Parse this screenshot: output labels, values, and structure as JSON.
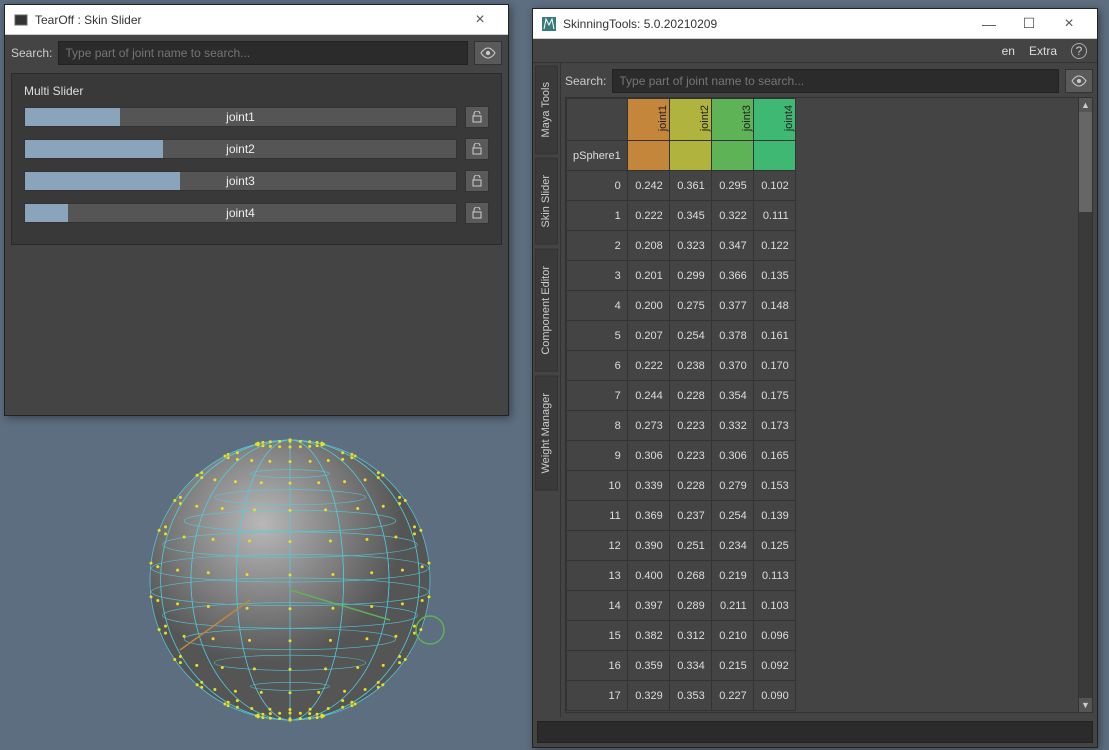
{
  "tearoff": {
    "title": "TearOff : Skin Slider",
    "search_label": "Search:",
    "search_placeholder": "Type part of joint name to search...",
    "panel_title": "Multi Slider",
    "sliders": [
      {
        "label": "joint1",
        "fill": 22
      },
      {
        "label": "joint2",
        "fill": 32
      },
      {
        "label": "joint3",
        "fill": 36
      },
      {
        "label": "joint4",
        "fill": 10
      }
    ]
  },
  "skintools": {
    "title": "SkinningTools: 5.0.20210209",
    "menu": {
      "lang": "en",
      "extra": "Extra"
    },
    "tabs": [
      "Maya Tools",
      "Skin Slider",
      "Component Editor",
      "Weight Manager"
    ],
    "search_label": "Search:",
    "search_placeholder": "Type part of joint name to search...",
    "mesh": "pSphere1",
    "joints": [
      {
        "name": "joint1",
        "color": "#c4863a"
      },
      {
        "name": "joint2",
        "color": "#b0b33d"
      },
      {
        "name": "joint3",
        "color": "#5eb356"
      },
      {
        "name": "joint4",
        "color": "#3fb874"
      }
    ],
    "rows": [
      {
        "i": 0,
        "v": [
          "0.242",
          "0.361",
          "0.295",
          "0.102"
        ]
      },
      {
        "i": 1,
        "v": [
          "0.222",
          "0.345",
          "0.322",
          "0.111"
        ]
      },
      {
        "i": 2,
        "v": [
          "0.208",
          "0.323",
          "0.347",
          "0.122"
        ]
      },
      {
        "i": 3,
        "v": [
          "0.201",
          "0.299",
          "0.366",
          "0.135"
        ]
      },
      {
        "i": 4,
        "v": [
          "0.200",
          "0.275",
          "0.377",
          "0.148"
        ]
      },
      {
        "i": 5,
        "v": [
          "0.207",
          "0.254",
          "0.378",
          "0.161"
        ]
      },
      {
        "i": 6,
        "v": [
          "0.222",
          "0.238",
          "0.370",
          "0.170"
        ]
      },
      {
        "i": 7,
        "v": [
          "0.244",
          "0.228",
          "0.354",
          "0.175"
        ]
      },
      {
        "i": 8,
        "v": [
          "0.273",
          "0.223",
          "0.332",
          "0.173"
        ]
      },
      {
        "i": 9,
        "v": [
          "0.306",
          "0.223",
          "0.306",
          "0.165"
        ]
      },
      {
        "i": 10,
        "v": [
          "0.339",
          "0.228",
          "0.279",
          "0.153"
        ]
      },
      {
        "i": 11,
        "v": [
          "0.369",
          "0.237",
          "0.254",
          "0.139"
        ]
      },
      {
        "i": 12,
        "v": [
          "0.390",
          "0.251",
          "0.234",
          "0.125"
        ]
      },
      {
        "i": 13,
        "v": [
          "0.400",
          "0.268",
          "0.219",
          "0.113"
        ]
      },
      {
        "i": 14,
        "v": [
          "0.397",
          "0.289",
          "0.211",
          "0.103"
        ]
      },
      {
        "i": 15,
        "v": [
          "0.382",
          "0.312",
          "0.210",
          "0.096"
        ]
      },
      {
        "i": 16,
        "v": [
          "0.359",
          "0.334",
          "0.215",
          "0.092"
        ]
      },
      {
        "i": 17,
        "v": [
          "0.329",
          "0.353",
          "0.227",
          "0.090"
        ]
      }
    ]
  }
}
